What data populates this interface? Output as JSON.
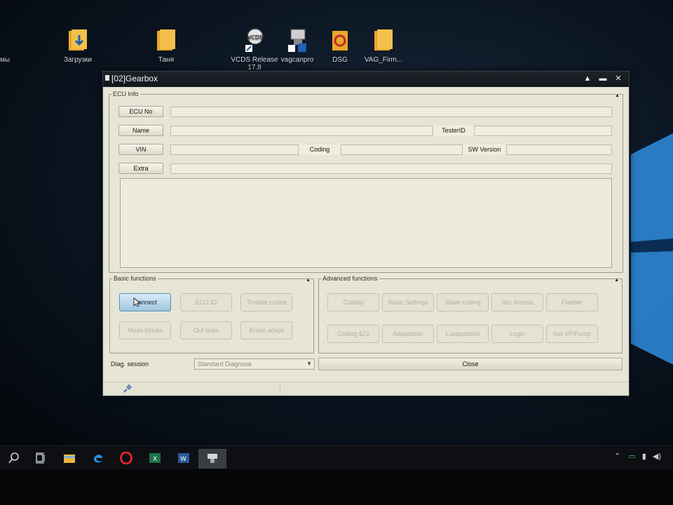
{
  "desktop": {
    "cut_label": "мы",
    "icons": [
      {
        "label": "Загрузки",
        "icon": "downloads-folder-icon"
      },
      {
        "label": "Таня",
        "icon": "folder-icon"
      },
      {
        "label": "VCDS Release 17.8",
        "icon": "vcds-shortcut-icon"
      },
      {
        "label": "vagcanpro",
        "icon": "vagcanpro-shortcut-icon"
      },
      {
        "label": "DSG",
        "icon": "dsg-folder-icon"
      },
      {
        "label": "VAG_Firm...",
        "icon": "folder-icon"
      }
    ]
  },
  "window": {
    "title": "[02]Gearbox",
    "controls": {
      "minimize": "▲",
      "restore": "▬",
      "close": "✕"
    },
    "ecu_info": {
      "legend": "ECU Info",
      "ecu_no_label": "ECU No",
      "name_label": "Name",
      "tester_id_label": "TesterID",
      "vin_label": "VIN",
      "coding_label": "Coding",
      "sw_version_label": "SW Version",
      "extra_label": "Extra",
      "ecu_no_value": "",
      "name_value": "",
      "tester_id_value": "",
      "vin_value": "",
      "coding_value": "",
      "sw_version_value": "",
      "extra_value": ""
    },
    "basic": {
      "legend": "Basic functions",
      "buttons": [
        "Connect",
        "ECU ID",
        "Trouble codes",
        "Meas blocks",
        "Out tests",
        "Erase adapt"
      ]
    },
    "advanced": {
      "legend": "Advanced functions",
      "buttons": [
        "Coding",
        "Basic Settings",
        "Slave coding",
        "Sec Access",
        "Flasher",
        "Coding $22",
        "Adaptation",
        "L.adaptation",
        "Login",
        "Set VP/Pump"
      ]
    },
    "diag_session_label": "Diag. session",
    "diag_session_value": "Standard Diagnose",
    "close_label": "Close"
  },
  "taskbar": {
    "items": [
      "search-icon",
      "task-view-icon",
      "file-explorer-icon",
      "edge-icon",
      "opera-icon",
      "excel-icon",
      "word-icon",
      "vag-adapter-icon"
    ],
    "active_index": 7,
    "tray": [
      "chevron-up-icon",
      "battery-icon",
      "network-icon",
      "volume-icon"
    ]
  },
  "colors": {
    "window_bg": "#e7e6d6",
    "titlebar": "#161b21",
    "active_button": "#9fc7e0"
  }
}
